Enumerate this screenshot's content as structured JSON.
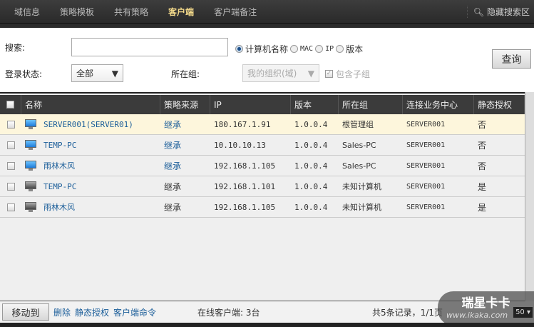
{
  "nav": {
    "tabs": [
      "域信息",
      "策略模板",
      "共有策略",
      "客户端",
      "客户端备注"
    ],
    "active": 3,
    "hide_search": "隐藏搜索区"
  },
  "search": {
    "label": "搜索:",
    "value": "",
    "placeholder": "",
    "options": [
      "计算机名称",
      "MAC",
      "IP",
      "版本"
    ],
    "selected": 0,
    "query_button": "查询",
    "login_label": "登录状态:",
    "login_value": "全部",
    "group_label": "所在组:",
    "group_value": "我的组织(域)",
    "include_sub": "包含子组",
    "include_sub_checked": true
  },
  "table": {
    "headers": [
      "名称",
      "策略来源",
      "IP",
      "版本",
      "所在组",
      "连接业务中心",
      "静态授权"
    ],
    "rows": [
      {
        "name": "SERVER001(SERVER01)",
        "source": "继承",
        "ip": "180.167.1.91",
        "version": "1.0.0.4",
        "group": "根管理组",
        "center": "SERVER001",
        "static": "否",
        "online": true
      },
      {
        "name": "TEMP-PC",
        "source": "继承",
        "ip": "10.10.10.13",
        "version": "1.0.0.4",
        "group": "Sales-PC",
        "center": "SERVER001",
        "static": "否",
        "online": true
      },
      {
        "name": "雨林木风",
        "source": "继承",
        "ip": "192.168.1.105",
        "version": "1.0.0.4",
        "group": "Sales-PC",
        "center": "SERVER001",
        "static": "否",
        "online": true
      },
      {
        "name": "TEMP-PC",
        "source": "继承",
        "ip": "192.168.1.101",
        "version": "1.0.0.4",
        "group": "未知计算机",
        "center": "SERVER001",
        "static": "是",
        "online": false
      },
      {
        "name": "雨林木风",
        "source": "继承",
        "ip": "192.168.1.105",
        "version": "1.0.0.4",
        "group": "未知计算机",
        "center": "SERVER001",
        "static": "是",
        "online": false
      }
    ]
  },
  "footer": {
    "move_to": "移动到",
    "delete": "删除",
    "static_auth": "静态授权",
    "client_cmd": "客户端命令",
    "online": "在线客户端: 3台",
    "records": "共5条记录，1/1页",
    "page_size": "50"
  },
  "watermark": {
    "brand": "瑞星卡卡",
    "url": "www.ikaka.com"
  }
}
